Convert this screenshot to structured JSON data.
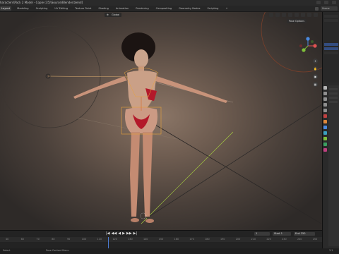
{
  "window": {
    "title": "haracters\\Pack 2 Model - Copie (35)\\Source\\Blender.blend]"
  },
  "workspaces": [
    "Layout",
    "Modeling",
    "Sculpting",
    "UV Editing",
    "Texture Paint",
    "Shading",
    "Animation",
    "Rendering",
    "Compositing",
    "Geometry Nodes",
    "Scripting",
    "+"
  ],
  "active_workspace": "Layout",
  "header_right": {
    "scene": "Scene"
  },
  "viewport": {
    "mode": "Global",
    "pose_options": "Pose Options",
    "colors": {
      "bone_outline": "#e8a23a",
      "bone_wire": "#d86a2a",
      "gizmo_x": "#e05252",
      "gizmo_y": "#7fbf3a",
      "gizmo_z": "#4a8ae0"
    },
    "gizmo_labels": {
      "x": "X",
      "y": "Y",
      "z": "Z"
    }
  },
  "timeline": {
    "current_frame": "1",
    "start_label": "Start",
    "start_value": "1",
    "end_label": "End",
    "end_value": "250",
    "ruler": [
      "40",
      "60",
      "70",
      "80",
      "90",
      "100",
      "110",
      "120",
      "130",
      "140",
      "150",
      "160",
      "170",
      "180",
      "190",
      "200",
      "210",
      "220",
      "230",
      "240",
      "250"
    ],
    "play_icons": [
      "|◀",
      "◀◀",
      "◀",
      "▶",
      "▶▶",
      "▶|"
    ]
  },
  "statusbar": {
    "left": "Select",
    "mid": "Pose Context Menu",
    "right": "3.1"
  },
  "icons": {
    "gizmo": "navigation-gizmo-icon",
    "zoom": "zoom-icon",
    "pan": "pan-icon",
    "camera": "camera-icon",
    "grid": "grid-icon"
  }
}
